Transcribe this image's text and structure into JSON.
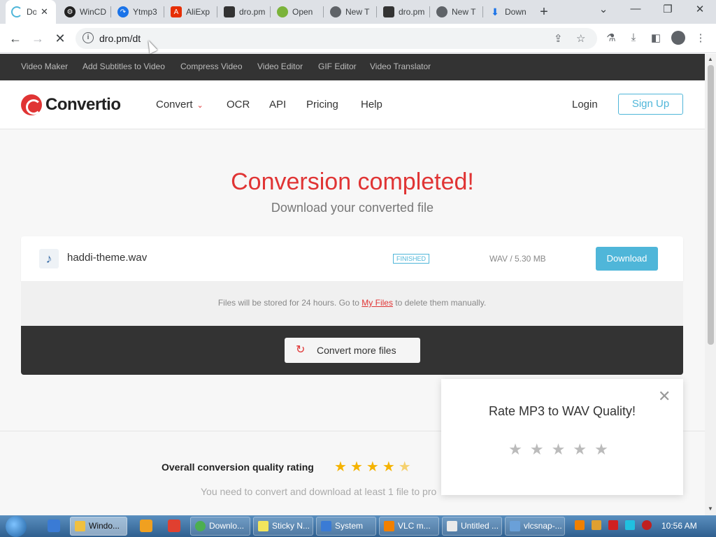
{
  "browser": {
    "tabs": [
      {
        "title": "Do",
        "active": true,
        "color": "#4fb6d9"
      },
      {
        "title": "WinCD",
        "color": "#222"
      },
      {
        "title": "Ytmp3",
        "color": "#1a73e8"
      },
      {
        "title": "AliExp",
        "color": "#e62e04"
      },
      {
        "title": "dro.pm",
        "color": "#333"
      },
      {
        "title": "Open",
        "color": "#7bb33a"
      },
      {
        "title": "New T",
        "color": "#5f6368"
      },
      {
        "title": "dro.pm",
        "color": "#333"
      },
      {
        "title": "New T",
        "color": "#5f6368"
      },
      {
        "title": "Down",
        "color": "#1a73e8"
      }
    ],
    "url": "dro.pm/dt"
  },
  "topnav": {
    "items": [
      "Video Maker",
      "Add Subtitles to Video",
      "Compress Video",
      "Video Editor",
      "GIF Editor",
      "Video Translator"
    ]
  },
  "header": {
    "logo": "Convertio",
    "nav": [
      "Convert",
      "OCR",
      "API",
      "Pricing",
      "Help"
    ],
    "login": "Login",
    "signup": "Sign Up"
  },
  "main": {
    "headline": "Conversion completed!",
    "subline": "Download your converted file",
    "file": {
      "name": "haddi-theme.wav",
      "status": "FINISHED",
      "format_size": "WAV / 5.30 MB",
      "download": "Download"
    },
    "storage_note_pre": "Files will be stored for 24 hours. Go to",
    "storage_note_link": "My Files",
    "storage_note_post": "to delete them manually.",
    "convert_more": "Convert more files"
  },
  "rating": {
    "label": "Overall conversion quality rating",
    "value": 4.5,
    "max": 5,
    "note": "You need to convert and download at least 1 file to pro"
  },
  "popup": {
    "title": "Rate MP3 to WAV Quality!",
    "stars": 5
  },
  "taskbar": {
    "tasks": [
      {
        "label": "Windo...",
        "active": true,
        "color": "#f0c040"
      },
      {
        "label": "Downlo...",
        "color": "#4caf50"
      },
      {
        "label": "Sticky N...",
        "color": "#f2e55c"
      },
      {
        "label": "System",
        "color": "#3a7bd5"
      },
      {
        "label": "VLC m...",
        "color": "#f08000"
      },
      {
        "label": "Untitled ...",
        "color": "#eaeaea"
      },
      {
        "label": "vlcsnap-...",
        "color": "#6aa0d8"
      }
    ],
    "clock": "10:56 AM"
  },
  "colors": {
    "brand_red": "#e03434",
    "accent_blue": "#4fb6d9"
  }
}
